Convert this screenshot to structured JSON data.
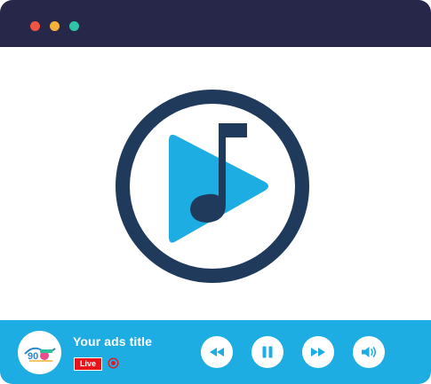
{
  "window": {
    "controls": [
      "close",
      "minimize",
      "maximize"
    ],
    "colors": {
      "titlebar": "#272849",
      "close": "#f05543",
      "minimize": "#f3b23a",
      "maximize": "#2fc2a6"
    }
  },
  "logo": {
    "icon": "music-play-logo-icon",
    "colors": {
      "ring": "#1f3a5a",
      "play": "#1eade2",
      "note": "#1f3a5a"
    }
  },
  "player": {
    "station_logo_icon": "station-logo-icon",
    "title": "Your ads title",
    "live_label": "Live",
    "record_icon": "record-icon",
    "controls": {
      "rewind_icon": "rewind-icon",
      "pause_icon": "pause-icon",
      "forward_icon": "fast-forward-icon",
      "volume_icon": "volume-icon"
    },
    "colors": {
      "bar": "#1eade2",
      "live": "#e8141b"
    }
  }
}
